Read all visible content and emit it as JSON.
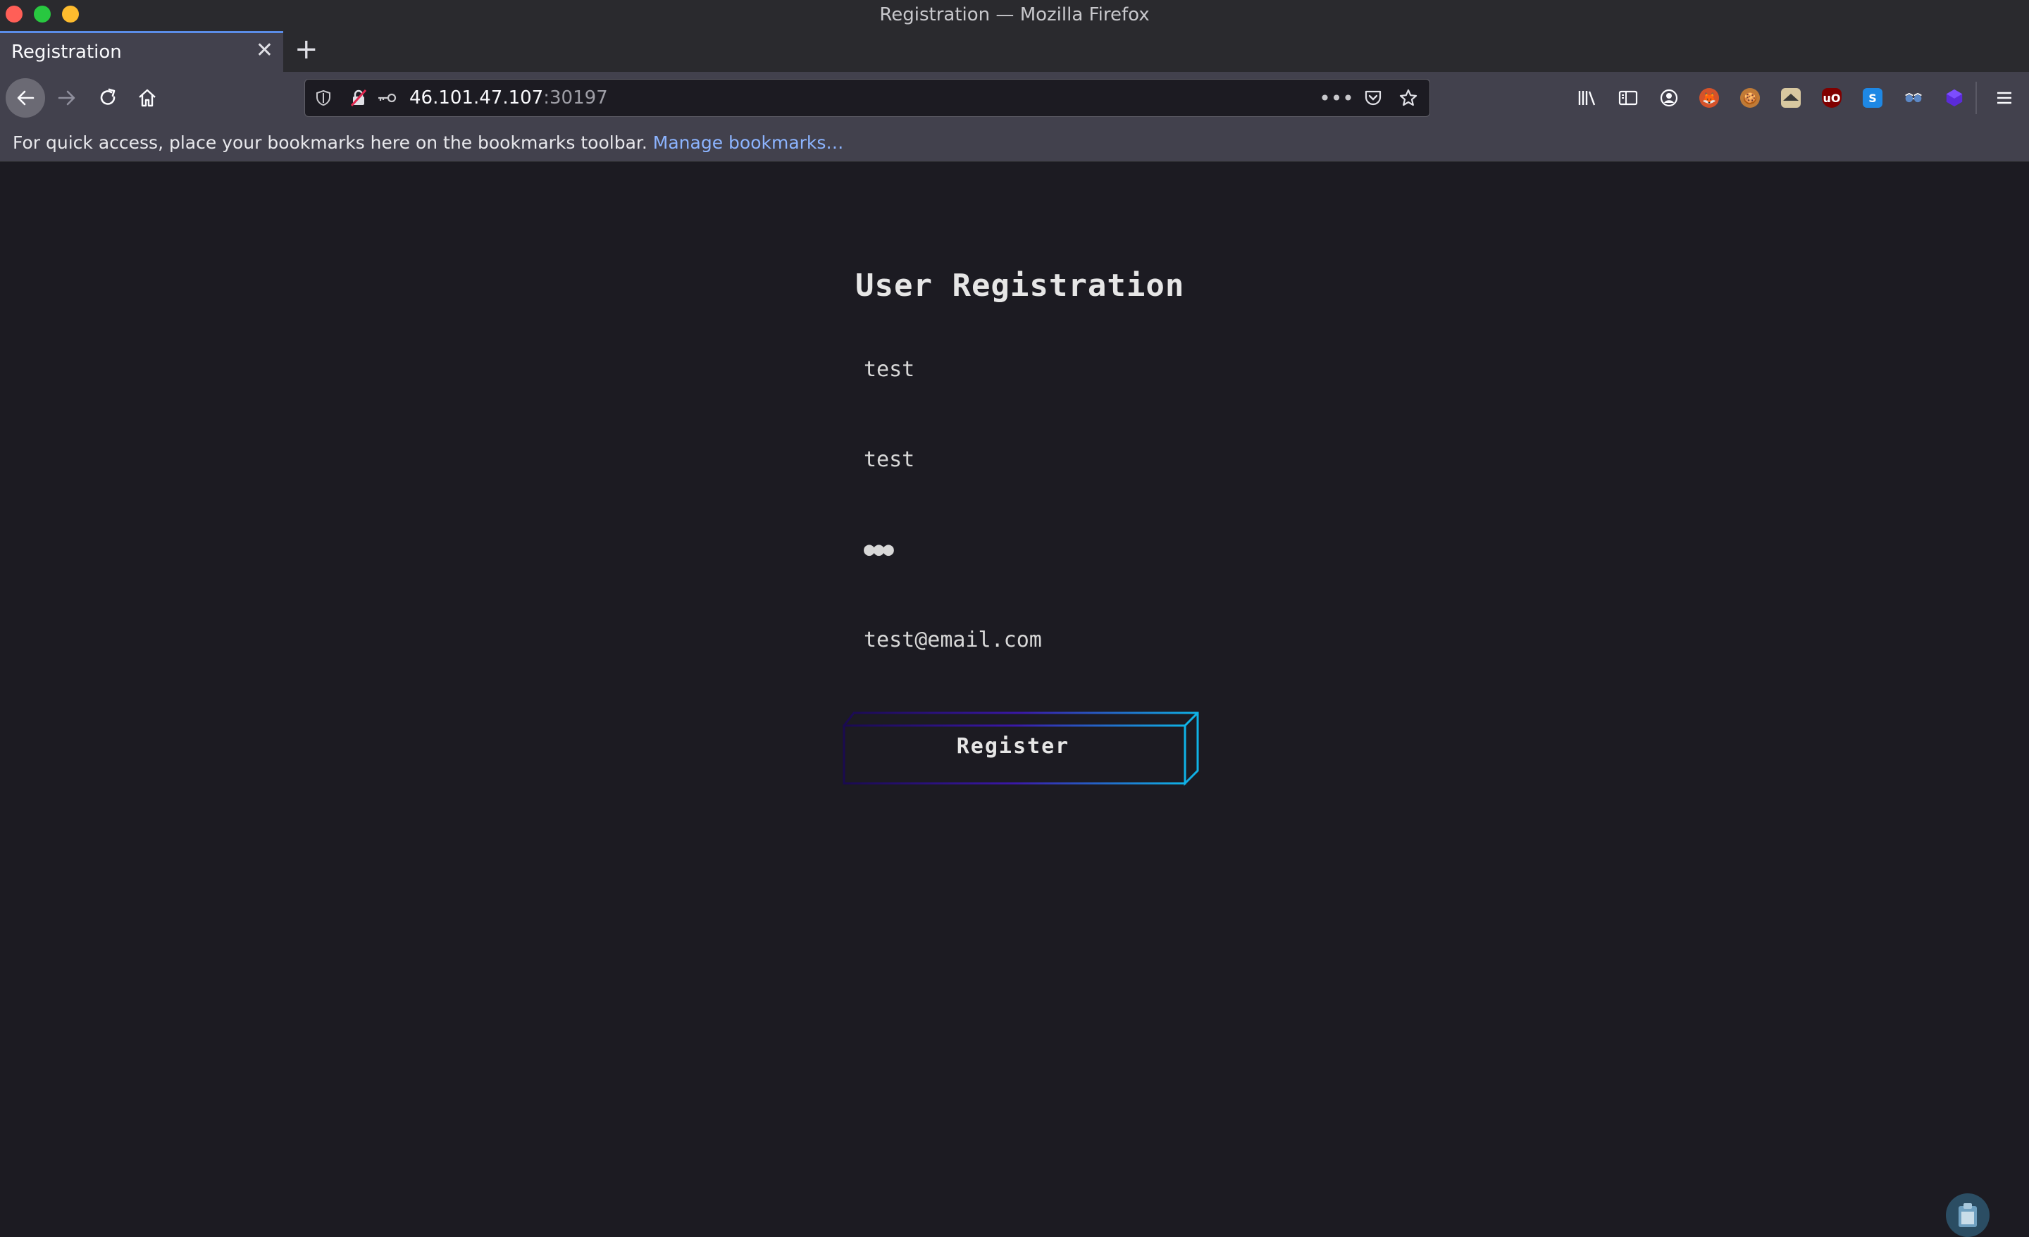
{
  "window": {
    "title": "Registration — Mozilla Firefox"
  },
  "tabs": [
    {
      "title": "Registration",
      "active": true
    }
  ],
  "toolbar": {
    "url_host": "46.101.47.107",
    "url_port": ":30197"
  },
  "bookmarks_bar": {
    "message": "For quick access, place your bookmarks here on the bookmarks toolbar.",
    "link": "Manage bookmarks…"
  },
  "page": {
    "heading": "User Registration",
    "fields": {
      "username": "test",
      "name": "test",
      "password": "●●●",
      "email": "test@email.com"
    },
    "register_label": "Register"
  },
  "colors": {
    "background": "#1c1b22",
    "button_gradient_start": "#1a0a50",
    "button_gradient_end": "#0fb3e6",
    "link": "#8cb4ff"
  },
  "extensions": [
    "library-icon",
    "sidebar-icon",
    "account-icon",
    "foxyproxy-icon",
    "cookie-editor-icon",
    "bookmark-ext-icon",
    "ublock-icon",
    "s-ext-icon",
    "spy-glasses-icon",
    "cube-ext-icon",
    "menu-icon"
  ]
}
